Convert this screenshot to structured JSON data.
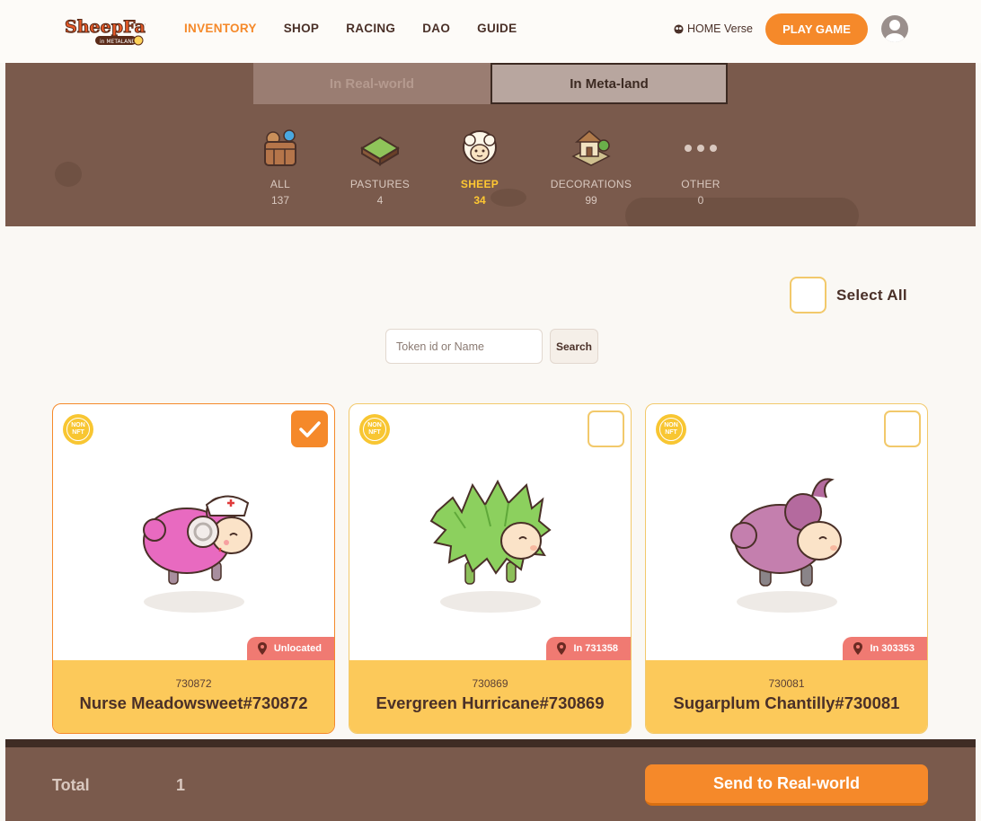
{
  "header": {
    "logo_text": "SheepFarm",
    "logo_sub": "in METALAND",
    "nav": [
      {
        "label": "INVENTORY",
        "active": true
      },
      {
        "label": "SHOP",
        "active": false
      },
      {
        "label": "RACING",
        "active": false
      },
      {
        "label": "DAO",
        "active": false
      },
      {
        "label": "GUIDE",
        "active": false
      }
    ],
    "homeverse": "HOME Verse",
    "play_label": "PLAY GAME"
  },
  "tabs": {
    "real": "In Real-world",
    "meta": "In Meta-land",
    "active": "meta"
  },
  "categories": [
    {
      "name": "ALL",
      "count": "137",
      "icon": "basket-icon"
    },
    {
      "name": "PASTURES",
      "count": "4",
      "icon": "pasture-icon"
    },
    {
      "name": "SHEEP",
      "count": "34",
      "icon": "sheep-icon",
      "active": true
    },
    {
      "name": "DECORATIONS",
      "count": "99",
      "icon": "house-icon"
    },
    {
      "name": "OTHER",
      "count": "0",
      "icon": "more-dots-icon"
    }
  ],
  "select_all": "Select All",
  "search": {
    "placeholder": "Token id or Name",
    "button": "Search"
  },
  "cards": [
    {
      "badge": "NON NFT",
      "token": "730872",
      "name": "Nurse Meadowsweet#730872",
      "location": "Unlocated",
      "selected": true
    },
    {
      "badge": "NON NFT",
      "token": "730869",
      "name": "Evergreen Hurricane#730869",
      "location": "In 731358",
      "selected": false
    },
    {
      "badge": "NON NFT",
      "token": "730081",
      "name": "Sugarplum Chantilly#730081",
      "location": "In 303353",
      "selected": false
    }
  ],
  "footer": {
    "total_label": "Total",
    "total_value": "1",
    "send_label": "Send to Real-world"
  },
  "colors": {
    "accent": "#f5892a",
    "banner": "#7a5a4c",
    "active_category": "#ffc832",
    "card_footer": "#fcc95a",
    "location_badge": "#f07a72"
  }
}
